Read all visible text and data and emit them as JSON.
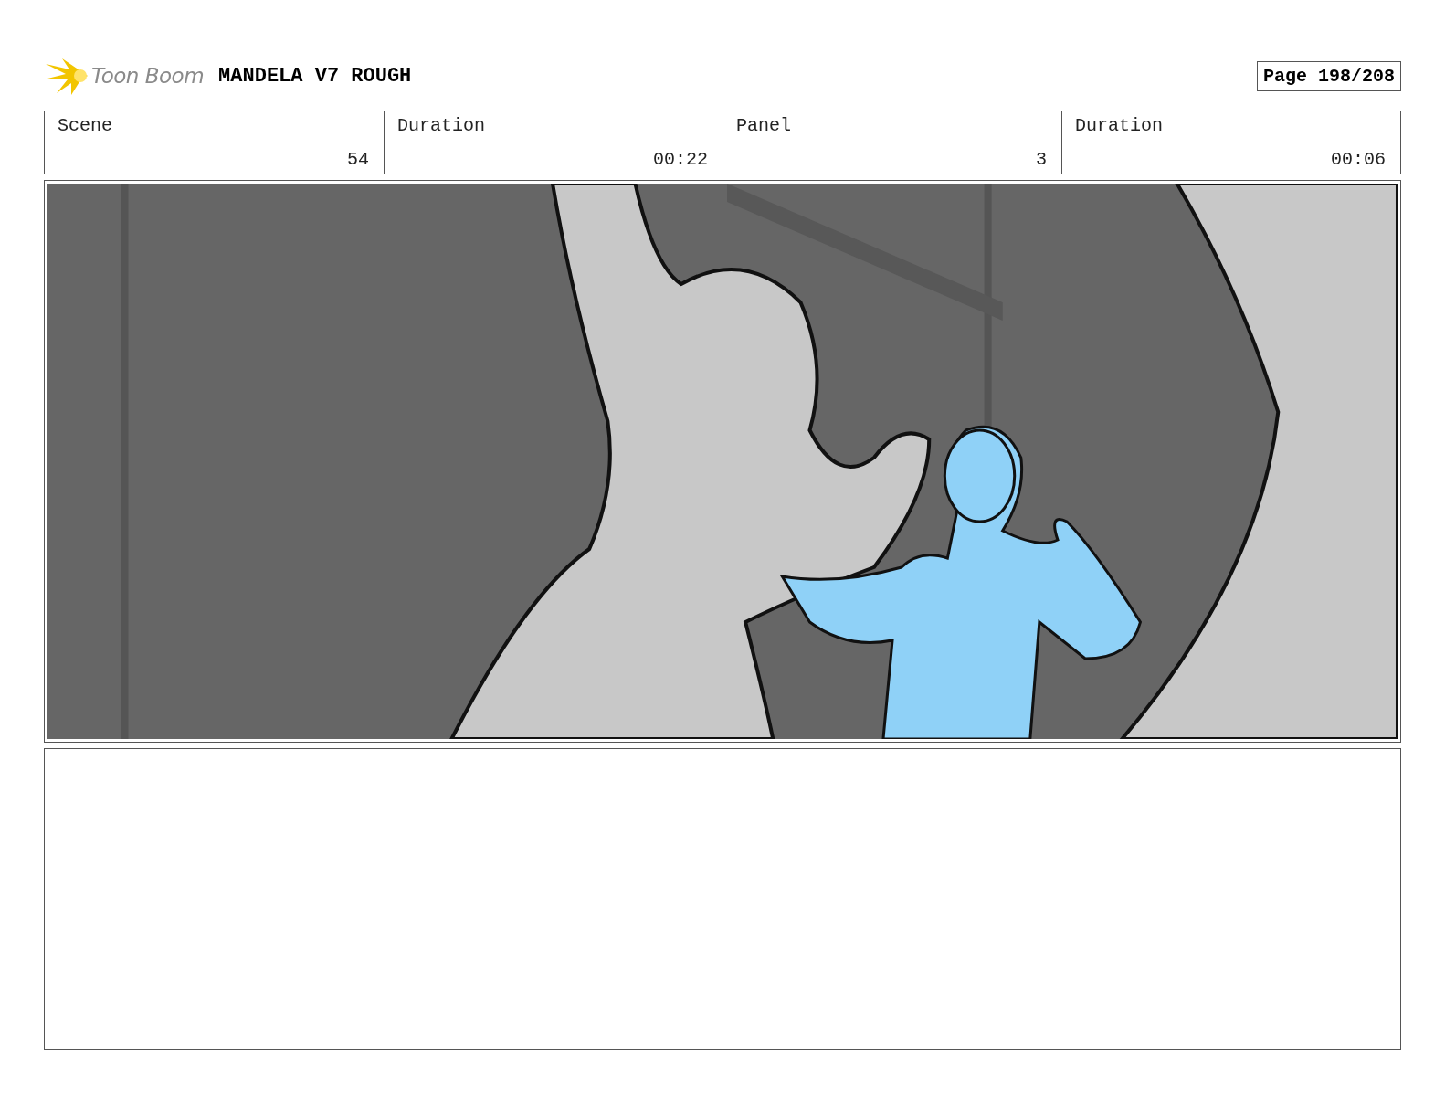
{
  "header": {
    "logo_text": "Toon Boom",
    "project_title": "MANDELA V7 ROUGH",
    "page": "Page 198/208"
  },
  "info_fields": [
    {
      "label": "Scene",
      "value": "54"
    },
    {
      "label": "Duration",
      "value": "00:22"
    },
    {
      "label": "Panel",
      "value": "3"
    },
    {
      "label": "Duration",
      "value": "00:06"
    }
  ]
}
